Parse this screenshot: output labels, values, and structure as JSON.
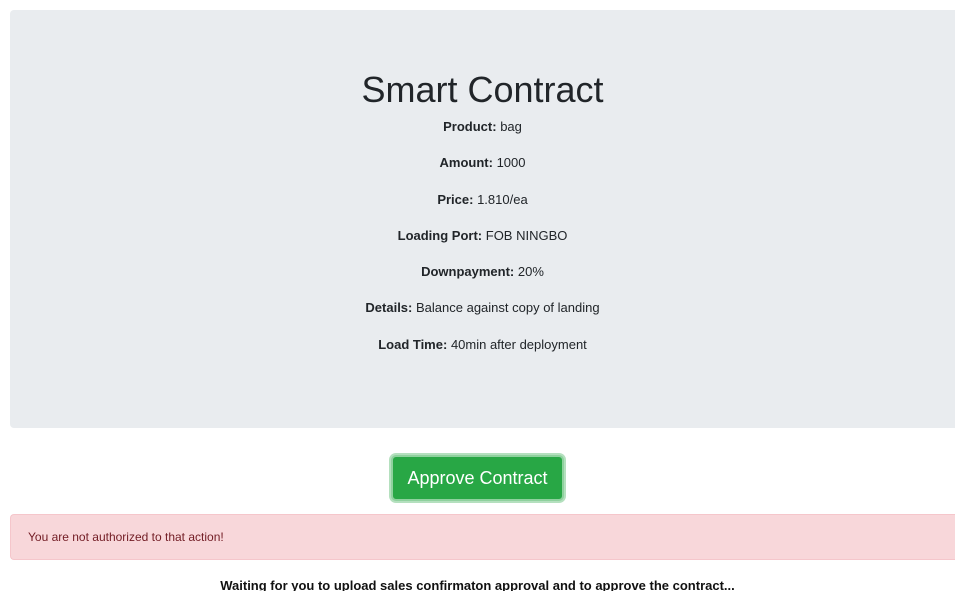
{
  "contract": {
    "title": "Smart Contract",
    "fields": [
      {
        "key": "Product:",
        "value": "bag"
      },
      {
        "key": "Amount:",
        "value": "1000"
      },
      {
        "key": "Price:",
        "value": "1.810/ea"
      },
      {
        "key": "Loading Port:",
        "value": "FOB NINGBO"
      },
      {
        "key": "Downpayment:",
        "value": "20%"
      },
      {
        "key": "Details:",
        "value": "Balance against copy of landing"
      },
      {
        "key": "Load Time:",
        "value": "40min after deployment"
      }
    ]
  },
  "actions": {
    "approve_label": "Approve Contract"
  },
  "alert": {
    "message": "You are not authorized to that action!"
  },
  "status": {
    "message": "Waiting for you to upload sales confirmaton approval and to approve the contract..."
  },
  "colors": {
    "jumbotron_bg": "#e9ecef",
    "success": "#28a745",
    "danger_bg": "#f8d7da",
    "danger_text": "#721c24"
  }
}
